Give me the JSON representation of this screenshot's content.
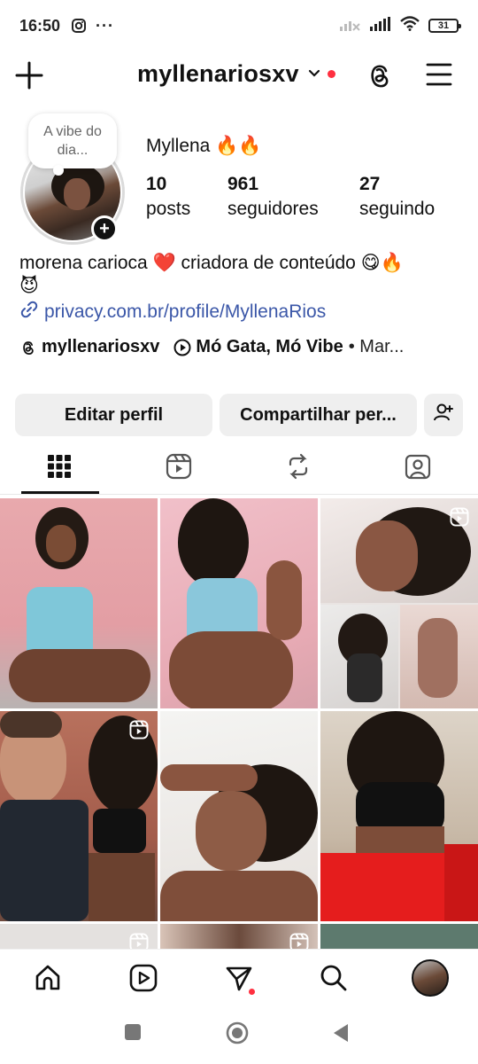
{
  "status_bar": {
    "time": "16:50",
    "dots": "···",
    "battery": "31"
  },
  "header": {
    "username": "myllenariosxv"
  },
  "profile": {
    "note": "A vibe do dia...",
    "display_name": "Myllena 🔥🔥",
    "stats": [
      {
        "value": "10",
        "label": "posts"
      },
      {
        "value": "961",
        "label": "seguidores"
      },
      {
        "value": "27",
        "label": "seguindo"
      }
    ],
    "bio_line1": "morena carioca ❤️ criadora de conteúdo 😋🔥",
    "bio_line2": "😈",
    "link": "privacy.com.br/profile/MyllenaRios",
    "threads_handle": "myllenariosxv",
    "music_title": "Mó Gata, Mó Vibe",
    "music_artist": "• Mar..."
  },
  "buttons": {
    "edit": "Editar perfil",
    "share": "Compartilhar per..."
  },
  "tabs": [
    "grid-icon",
    "reels-icon",
    "reposts-icon",
    "tagged-icon"
  ],
  "colors": {
    "accent_red": "#ff3040",
    "link_blue": "#3b57a8",
    "button_bg": "#efefef"
  },
  "icons": [
    "plus-icon",
    "chevron-down-icon",
    "threads-icon",
    "menu-icon",
    "link-icon",
    "play-icon",
    "add-user-icon",
    "home-icon",
    "reels-icon",
    "send-icon",
    "search-icon",
    "avatar"
  ]
}
